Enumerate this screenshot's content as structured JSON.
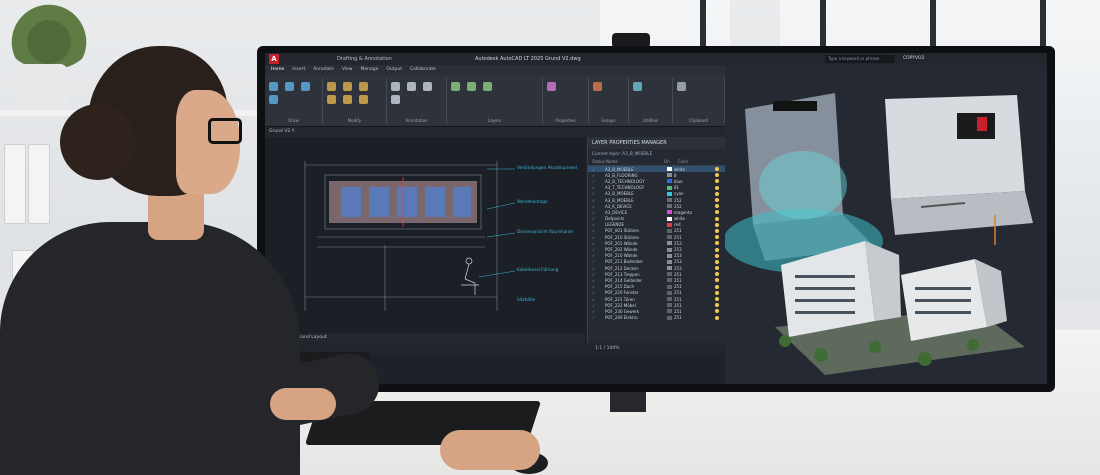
{
  "app": {
    "title": "Autodesk AutoCAD LT 2025   Grund V2.dwg",
    "workspace": "Drafting & Annotation",
    "search_placeholder": "Type a keyword or phrase",
    "user": "COPYVO2",
    "logo_letter": "A"
  },
  "ribbon": {
    "tabs": [
      "Home",
      "Insert",
      "Annotate",
      "View",
      "Manage",
      "Output",
      "Collaborate"
    ],
    "groups": [
      {
        "label": "Draw",
        "tools": [
          "Line",
          "Polyline",
          "Circle",
          "Arc"
        ]
      },
      {
        "label": "Modify",
        "tools": [
          "Move",
          "Copy",
          "Stretch",
          "Trim",
          "Fillet",
          "Array"
        ]
      },
      {
        "label": "Annotation",
        "tools": [
          "Text",
          "Dimension",
          "Leader",
          "Table"
        ]
      },
      {
        "label": "Layers",
        "tools": [
          "Layer Properties",
          "Make Current",
          "Match Layer"
        ]
      },
      {
        "label": "Properties",
        "tools": [
          "Match Properties"
        ]
      },
      {
        "label": "Groups",
        "tools": [
          "Group"
        ]
      },
      {
        "label": "Utilities",
        "tools": [
          "Measure"
        ]
      },
      {
        "label": "Clipboard",
        "tools": [
          "Paste"
        ]
      }
    ]
  },
  "document": {
    "tab": "Grund V2.Y",
    "layout_tabs": [
      "Model",
      "Grund Layout"
    ],
    "annotations": [
      "Verbindungen Akustikpaneel",
      "Wandmontage",
      "Deckenansicht Raumkante",
      "Kabelkanal Führung",
      "Sitzhöhe"
    ]
  },
  "layer_panel": {
    "title": "LAYER PROPERTIES MANAGER",
    "current": "Current layer: A3_B_MOEBLE",
    "search": "Search for layer",
    "headers": [
      "Status",
      "Name",
      "On",
      "Color"
    ],
    "rows": [
      {
        "name": "A3_B_MOEBLE",
        "color": "white",
        "hex": "#ffffff"
      },
      {
        "name": "A3_B_FLOORING",
        "color": "8",
        "hex": "#8a8f96"
      },
      {
        "name": "A3_B_TECHNOLOGY",
        "color": "blue",
        "hex": "#2f6fe0"
      },
      {
        "name": "A3_T_TECHNOLOGY",
        "color": "81",
        "hex": "#5bbd7a"
      },
      {
        "name": "A3_B_MOEBLE",
        "color": "cyan",
        "hex": "#33c6d9"
      },
      {
        "name": "A3_B_MOEBLE",
        "color": "252",
        "hex": "#6b6f75"
      },
      {
        "name": "A3_K_DEVICE",
        "color": "252",
        "hex": "#6b6f75"
      },
      {
        "name": "A3_DEVICE",
        "color": "magenta",
        "hex": "#d64fd6"
      },
      {
        "name": "Defpoints",
        "color": "white",
        "hex": "#ffffff"
      },
      {
        "name": "LEGENDE",
        "color": "red",
        "hex": "#e04040"
      },
      {
        "name": "POF_001 Stützen",
        "color": "251",
        "hex": "#5f6368"
      },
      {
        "name": "POF_210 Stützen",
        "color": "251",
        "hex": "#5f6368"
      },
      {
        "name": "POF_201 Wände",
        "color": "253",
        "hex": "#8a8f96"
      },
      {
        "name": "POF_202 Wände",
        "color": "253",
        "hex": "#8a8f96"
      },
      {
        "name": "POF_210 Wände",
        "color": "253",
        "hex": "#8a8f96"
      },
      {
        "name": "POF_211 Bodenbel",
        "color": "253",
        "hex": "#8a8f96"
      },
      {
        "name": "POF_212 Decken",
        "color": "253",
        "hex": "#8a8f96"
      },
      {
        "name": "POF_213 Treppen",
        "color": "251",
        "hex": "#5f6368"
      },
      {
        "name": "POF_214 Geländer",
        "color": "251",
        "hex": "#5f6368"
      },
      {
        "name": "POF_215 Dach",
        "color": "251",
        "hex": "#5f6368"
      },
      {
        "name": "POF_220 Fenster",
        "color": "251",
        "hex": "#5f6368"
      },
      {
        "name": "POF_221 Türen",
        "color": "251",
        "hex": "#5f6368"
      },
      {
        "name": "POF_222 Möbel",
        "color": "251",
        "hex": "#5f6368"
      },
      {
        "name": "POF_230 Gewerk",
        "color": "251",
        "hex": "#5f6368"
      },
      {
        "name": "POF_240 Elektro",
        "color": "251",
        "hex": "#5f6368"
      }
    ]
  },
  "statusbar": {
    "text": "MODEL",
    "scale": "1:1 / 100%"
  },
  "colors": {
    "accent": "#3db7d6",
    "cad_bg": "#1b1f26",
    "panel_bg": "#252a32",
    "autocad_red": "#c8202a"
  }
}
